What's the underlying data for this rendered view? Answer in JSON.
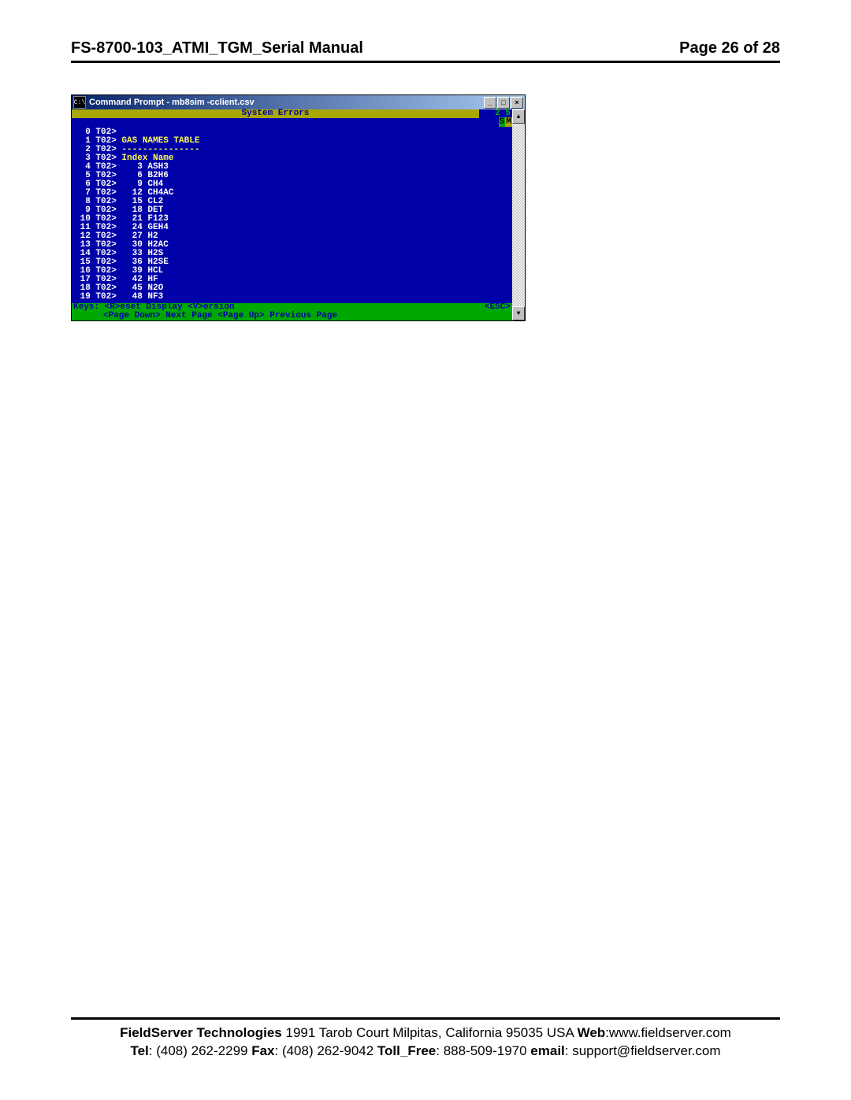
{
  "header": {
    "left": "FS-8700-103_ATMI_TGM_Serial Manual",
    "right": "Page 26 of 28"
  },
  "window": {
    "title": "Command Prompt - mb8sim -cclient.csv",
    "icon_label": "C:\\",
    "buttons": {
      "min": "_",
      "max": "□",
      "close": "×"
    },
    "status_title": "System Errors",
    "status_badge_num": "2 5",
    "status_badge_s": "S",
    "status_badge_m": "M",
    "header_line_1": "GAS NAMES TABLE",
    "header_line_2": "---------------",
    "header_line_3": "Index Name",
    "rows": [
      {
        "n": "0",
        "t": "T02>",
        "idx": "",
        "name": ""
      },
      {
        "n": "1",
        "t": "T02>",
        "idx": "",
        "name": "GAS NAMES TABLE"
      },
      {
        "n": "2",
        "t": "T02>",
        "idx": "",
        "name": "---------------"
      },
      {
        "n": "3",
        "t": "T02>",
        "idx": "",
        "name": "Index Name"
      },
      {
        "n": "4",
        "t": "T02>",
        "idx": "3",
        "name": "ASH3"
      },
      {
        "n": "5",
        "t": "T02>",
        "idx": "6",
        "name": "B2H6"
      },
      {
        "n": "6",
        "t": "T02>",
        "idx": "9",
        "name": "CH4"
      },
      {
        "n": "7",
        "t": "T02>",
        "idx": "12",
        "name": "CH4AC"
      },
      {
        "n": "8",
        "t": "T02>",
        "idx": "15",
        "name": "CL2"
      },
      {
        "n": "9",
        "t": "T02>",
        "idx": "18",
        "name": "DET"
      },
      {
        "n": "10",
        "t": "T02>",
        "idx": "21",
        "name": "F123"
      },
      {
        "n": "11",
        "t": "T02>",
        "idx": "24",
        "name": "GEH4"
      },
      {
        "n": "12",
        "t": "T02>",
        "idx": "27",
        "name": "H2"
      },
      {
        "n": "13",
        "t": "T02>",
        "idx": "30",
        "name": "H2AC"
      },
      {
        "n": "14",
        "t": "T02>",
        "idx": "33",
        "name": "H2S"
      },
      {
        "n": "15",
        "t": "T02>",
        "idx": "36",
        "name": "H2SE"
      },
      {
        "n": "16",
        "t": "T02>",
        "idx": "39",
        "name": "HCL"
      },
      {
        "n": "17",
        "t": "T02>",
        "idx": "42",
        "name": "HF"
      },
      {
        "n": "18",
        "t": "T02>",
        "idx": "45",
        "name": "N2O"
      },
      {
        "n": "19",
        "t": "T02>",
        "idx": "48",
        "name": "NF3"
      }
    ],
    "footer1_left": "Keys: <R>eset  Display <V>ersion",
    "footer1_right": "<ESC>",
    "footer2": "<Page Down> Next Page  <Page Up> Previous Page",
    "scroll_up": "▲",
    "scroll_down": "▼"
  },
  "docfooter": {
    "company": "FieldServer Technologies",
    "addr": " 1991 Tarob Court Milpitas, California 95035 USA  ",
    "web_l": "Web",
    "web_v": ":www.fieldserver.com",
    "tel_l": "Tel",
    "tel_v": ": (408) 262-2299  ",
    "fax_l": "Fax",
    "fax_v": ": (408) 262-9042   ",
    "toll_l": "Toll_Free",
    "toll_v": ": 888-509-1970   ",
    "email_l": "email",
    "email_v": ": support@fieldserver.com"
  }
}
